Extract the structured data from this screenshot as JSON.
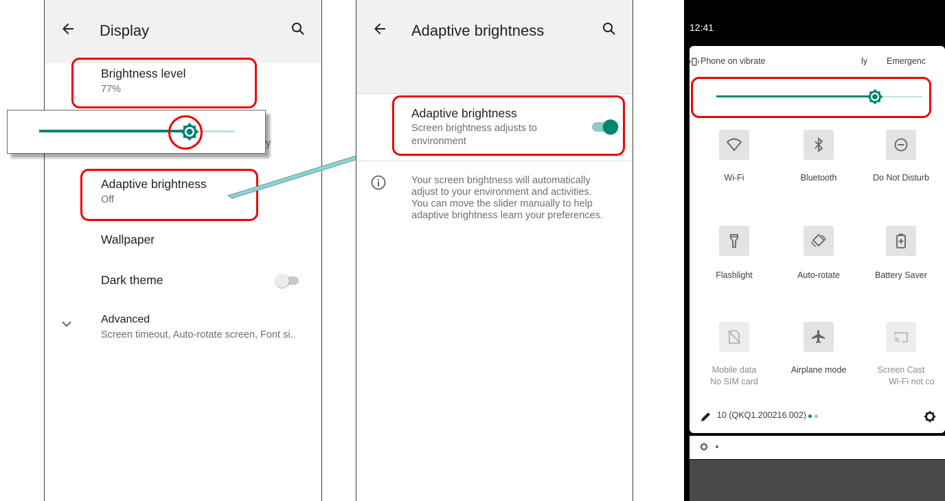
{
  "display": {
    "title": "Display",
    "brightness_title": "Brightness level",
    "brightness_value": "77%",
    "brightness_fraction": 0.77,
    "hidden_fragment": "y",
    "adaptive_title": "Adaptive brightness",
    "adaptive_value": "Off",
    "wallpaper": "Wallpaper",
    "dark_theme": "Dark theme",
    "dark_theme_on": false,
    "advanced_title": "Advanced",
    "advanced_sub": "Screen timeout, Auto-rotate screen, Font si.."
  },
  "adaptive": {
    "title": "Adaptive brightness",
    "item_title": "Adaptive brightness",
    "item_sub_1": "Screen brightness adjusts to",
    "item_sub_2": "environment",
    "enabled": true,
    "info_1": "Your screen brightness will automatically",
    "info_2": "adjust to your environment and activities.",
    "info_3": "You can move the slider manually to help",
    "info_4": "adaptive brightness learn your preferences."
  },
  "quick_settings": {
    "time": "12:41",
    "vibrate": "Phone on vibrate",
    "emergency_frag1": "ly",
    "emergency_frag2": "Emergenc",
    "brightness_fraction": 0.77,
    "tiles": {
      "wifi": "Wi-Fi",
      "bluetooth": "Bluetooth",
      "dnd": "Do Not Disturb",
      "flashlight": "Flashlight",
      "autorotate": "Auto-rotate",
      "battery": "Battery Saver",
      "mobile_1": "Mobile data",
      "mobile_2": "No SIM card",
      "airplane": "Airplane mode",
      "cast_1": "Screen Cast",
      "cast_2": "Wi-Fi not co"
    },
    "build": "10 (QKQ1.200216.002)"
  },
  "colors": {
    "accent": "#00856f",
    "track": "#bfe3dc",
    "annotation": "#ef0000",
    "arrow": "#7fd8d8"
  }
}
